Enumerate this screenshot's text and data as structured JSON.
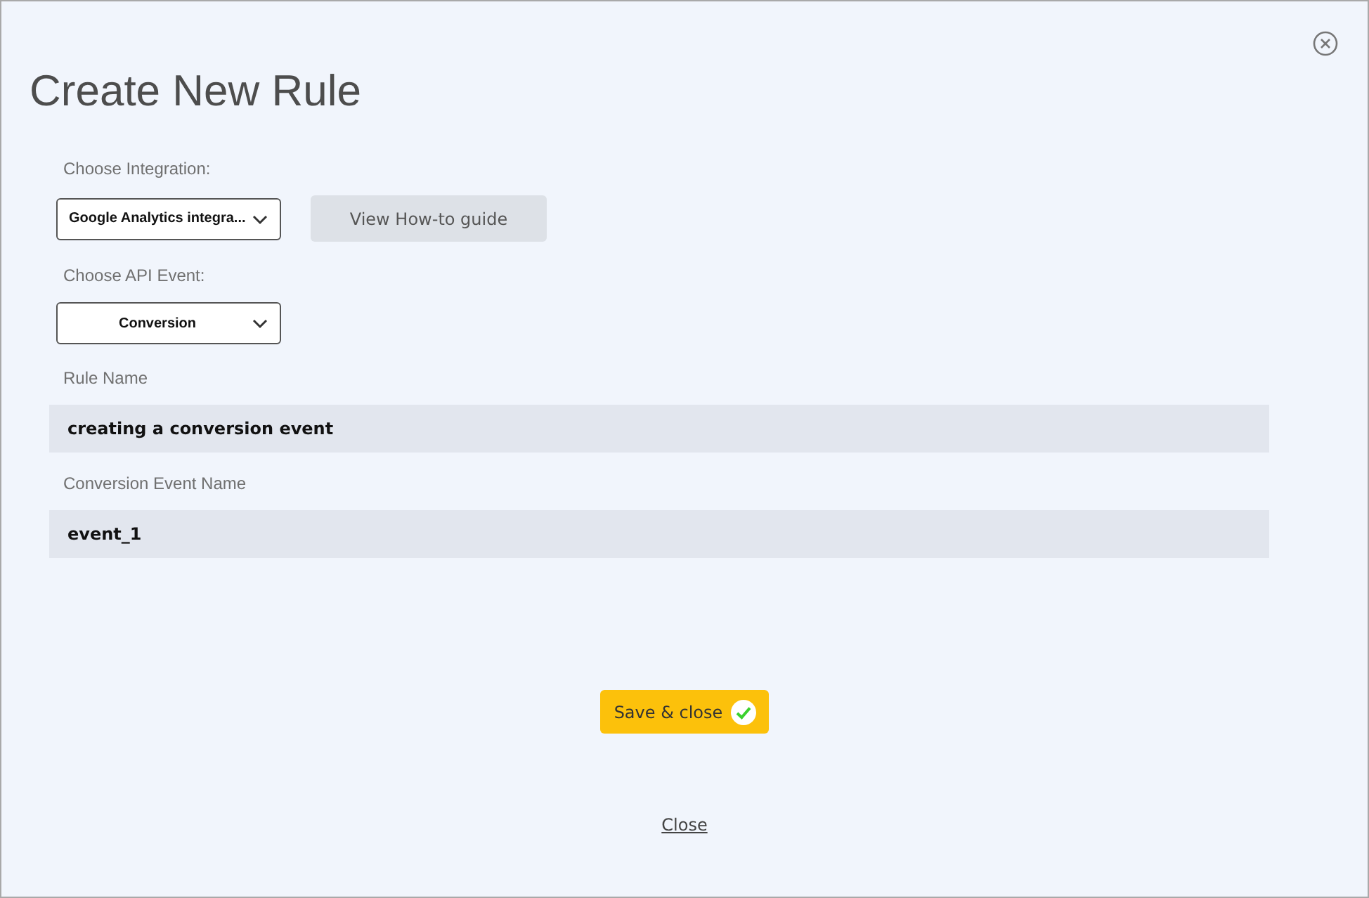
{
  "dialog": {
    "title": "Create New Rule"
  },
  "integration": {
    "label": "Choose Integration:",
    "value": "Google Analytics integra..."
  },
  "guide_button": {
    "label": "View How-to guide"
  },
  "api_event": {
    "label": "Choose API Event:",
    "value": "Conversion"
  },
  "rule_name": {
    "label": "Rule Name",
    "value": "creating a conversion event"
  },
  "event_name": {
    "label": "Conversion Event Name",
    "value": "event_1"
  },
  "save_button": {
    "label": "Save & close"
  },
  "close_link": {
    "label": "Close"
  }
}
